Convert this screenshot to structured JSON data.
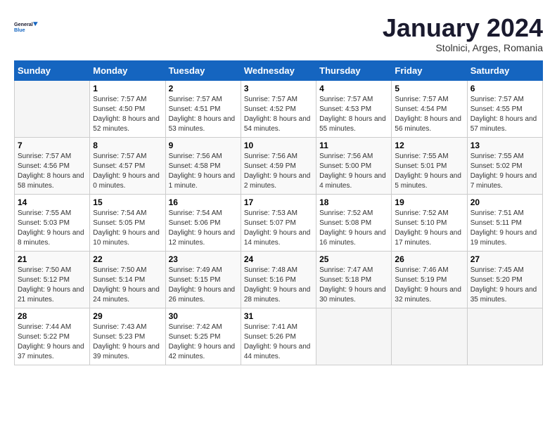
{
  "header": {
    "logo_line1": "General",
    "logo_line2": "Blue",
    "month_title": "January 2024",
    "location": "Stolnici, Arges, Romania"
  },
  "weekdays": [
    "Sunday",
    "Monday",
    "Tuesday",
    "Wednesday",
    "Thursday",
    "Friday",
    "Saturday"
  ],
  "weeks": [
    [
      {
        "day": "",
        "sunrise": "",
        "sunset": "",
        "daylight": ""
      },
      {
        "day": "1",
        "sunrise": "Sunrise: 7:57 AM",
        "sunset": "Sunset: 4:50 PM",
        "daylight": "Daylight: 8 hours and 52 minutes."
      },
      {
        "day": "2",
        "sunrise": "Sunrise: 7:57 AM",
        "sunset": "Sunset: 4:51 PM",
        "daylight": "Daylight: 8 hours and 53 minutes."
      },
      {
        "day": "3",
        "sunrise": "Sunrise: 7:57 AM",
        "sunset": "Sunset: 4:52 PM",
        "daylight": "Daylight: 8 hours and 54 minutes."
      },
      {
        "day": "4",
        "sunrise": "Sunrise: 7:57 AM",
        "sunset": "Sunset: 4:53 PM",
        "daylight": "Daylight: 8 hours and 55 minutes."
      },
      {
        "day": "5",
        "sunrise": "Sunrise: 7:57 AM",
        "sunset": "Sunset: 4:54 PM",
        "daylight": "Daylight: 8 hours and 56 minutes."
      },
      {
        "day": "6",
        "sunrise": "Sunrise: 7:57 AM",
        "sunset": "Sunset: 4:55 PM",
        "daylight": "Daylight: 8 hours and 57 minutes."
      }
    ],
    [
      {
        "day": "7",
        "sunrise": "Sunrise: 7:57 AM",
        "sunset": "Sunset: 4:56 PM",
        "daylight": "Daylight: 8 hours and 58 minutes."
      },
      {
        "day": "8",
        "sunrise": "Sunrise: 7:57 AM",
        "sunset": "Sunset: 4:57 PM",
        "daylight": "Daylight: 9 hours and 0 minutes."
      },
      {
        "day": "9",
        "sunrise": "Sunrise: 7:56 AM",
        "sunset": "Sunset: 4:58 PM",
        "daylight": "Daylight: 9 hours and 1 minute."
      },
      {
        "day": "10",
        "sunrise": "Sunrise: 7:56 AM",
        "sunset": "Sunset: 4:59 PM",
        "daylight": "Daylight: 9 hours and 2 minutes."
      },
      {
        "day": "11",
        "sunrise": "Sunrise: 7:56 AM",
        "sunset": "Sunset: 5:00 PM",
        "daylight": "Daylight: 9 hours and 4 minutes."
      },
      {
        "day": "12",
        "sunrise": "Sunrise: 7:55 AM",
        "sunset": "Sunset: 5:01 PM",
        "daylight": "Daylight: 9 hours and 5 minutes."
      },
      {
        "day": "13",
        "sunrise": "Sunrise: 7:55 AM",
        "sunset": "Sunset: 5:02 PM",
        "daylight": "Daylight: 9 hours and 7 minutes."
      }
    ],
    [
      {
        "day": "14",
        "sunrise": "Sunrise: 7:55 AM",
        "sunset": "Sunset: 5:03 PM",
        "daylight": "Daylight: 9 hours and 8 minutes."
      },
      {
        "day": "15",
        "sunrise": "Sunrise: 7:54 AM",
        "sunset": "Sunset: 5:05 PM",
        "daylight": "Daylight: 9 hours and 10 minutes."
      },
      {
        "day": "16",
        "sunrise": "Sunrise: 7:54 AM",
        "sunset": "Sunset: 5:06 PM",
        "daylight": "Daylight: 9 hours and 12 minutes."
      },
      {
        "day": "17",
        "sunrise": "Sunrise: 7:53 AM",
        "sunset": "Sunset: 5:07 PM",
        "daylight": "Daylight: 9 hours and 14 minutes."
      },
      {
        "day": "18",
        "sunrise": "Sunrise: 7:52 AM",
        "sunset": "Sunset: 5:08 PM",
        "daylight": "Daylight: 9 hours and 16 minutes."
      },
      {
        "day": "19",
        "sunrise": "Sunrise: 7:52 AM",
        "sunset": "Sunset: 5:10 PM",
        "daylight": "Daylight: 9 hours and 17 minutes."
      },
      {
        "day": "20",
        "sunrise": "Sunrise: 7:51 AM",
        "sunset": "Sunset: 5:11 PM",
        "daylight": "Daylight: 9 hours and 19 minutes."
      }
    ],
    [
      {
        "day": "21",
        "sunrise": "Sunrise: 7:50 AM",
        "sunset": "Sunset: 5:12 PM",
        "daylight": "Daylight: 9 hours and 21 minutes."
      },
      {
        "day": "22",
        "sunrise": "Sunrise: 7:50 AM",
        "sunset": "Sunset: 5:14 PM",
        "daylight": "Daylight: 9 hours and 24 minutes."
      },
      {
        "day": "23",
        "sunrise": "Sunrise: 7:49 AM",
        "sunset": "Sunset: 5:15 PM",
        "daylight": "Daylight: 9 hours and 26 minutes."
      },
      {
        "day": "24",
        "sunrise": "Sunrise: 7:48 AM",
        "sunset": "Sunset: 5:16 PM",
        "daylight": "Daylight: 9 hours and 28 minutes."
      },
      {
        "day": "25",
        "sunrise": "Sunrise: 7:47 AM",
        "sunset": "Sunset: 5:18 PM",
        "daylight": "Daylight: 9 hours and 30 minutes."
      },
      {
        "day": "26",
        "sunrise": "Sunrise: 7:46 AM",
        "sunset": "Sunset: 5:19 PM",
        "daylight": "Daylight: 9 hours and 32 minutes."
      },
      {
        "day": "27",
        "sunrise": "Sunrise: 7:45 AM",
        "sunset": "Sunset: 5:20 PM",
        "daylight": "Daylight: 9 hours and 35 minutes."
      }
    ],
    [
      {
        "day": "28",
        "sunrise": "Sunrise: 7:44 AM",
        "sunset": "Sunset: 5:22 PM",
        "daylight": "Daylight: 9 hours and 37 minutes."
      },
      {
        "day": "29",
        "sunrise": "Sunrise: 7:43 AM",
        "sunset": "Sunset: 5:23 PM",
        "daylight": "Daylight: 9 hours and 39 minutes."
      },
      {
        "day": "30",
        "sunrise": "Sunrise: 7:42 AM",
        "sunset": "Sunset: 5:25 PM",
        "daylight": "Daylight: 9 hours and 42 minutes."
      },
      {
        "day": "31",
        "sunrise": "Sunrise: 7:41 AM",
        "sunset": "Sunset: 5:26 PM",
        "daylight": "Daylight: 9 hours and 44 minutes."
      },
      {
        "day": "",
        "sunrise": "",
        "sunset": "",
        "daylight": ""
      },
      {
        "day": "",
        "sunrise": "",
        "sunset": "",
        "daylight": ""
      },
      {
        "day": "",
        "sunrise": "",
        "sunset": "",
        "daylight": ""
      }
    ]
  ]
}
